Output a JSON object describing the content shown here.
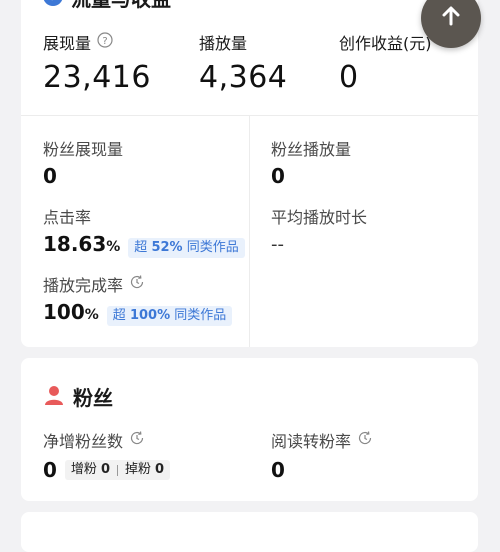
{
  "section_traffic": {
    "title": "流量与收益",
    "metrics": [
      {
        "label": "展现量",
        "value": "23,416"
      },
      {
        "label": "播放量",
        "value": "4,364"
      },
      {
        "label": "创作收益(元)",
        "value": "0"
      }
    ],
    "fan_impressions": {
      "label": "粉丝展现量",
      "value": "0"
    },
    "fan_plays": {
      "label": "粉丝播放量",
      "value": "0"
    },
    "ctr": {
      "label": "点击率",
      "value": "18.63",
      "unit": "%",
      "chip_prefix": "超",
      "chip_value": "52%",
      "chip_suffix": "同类作品"
    },
    "avg_duration": {
      "label": "平均播放时长",
      "value": "--"
    },
    "completion": {
      "label": "播放完成率",
      "value": "100",
      "unit": "%",
      "chip_prefix": "超",
      "chip_value": "100%",
      "chip_suffix": "同类作品"
    }
  },
  "section_fans": {
    "title": "粉丝",
    "net_fans": {
      "label": "净增粉丝数",
      "value": "0",
      "gain_label": "增粉",
      "gain_value": "0",
      "loss_label": "掉粉",
      "loss_value": "0"
    },
    "read_convert": {
      "label": "阅读转粉率",
      "value": "0"
    }
  },
  "colors": {
    "accent": "#3d78d6",
    "fan_icon": "#e85a5a",
    "background": "#f2f2f4"
  },
  "icons": [
    "check-badge-icon",
    "help-circle-icon",
    "clock-refresh-icon",
    "person-icon",
    "scroll-top-button"
  ]
}
